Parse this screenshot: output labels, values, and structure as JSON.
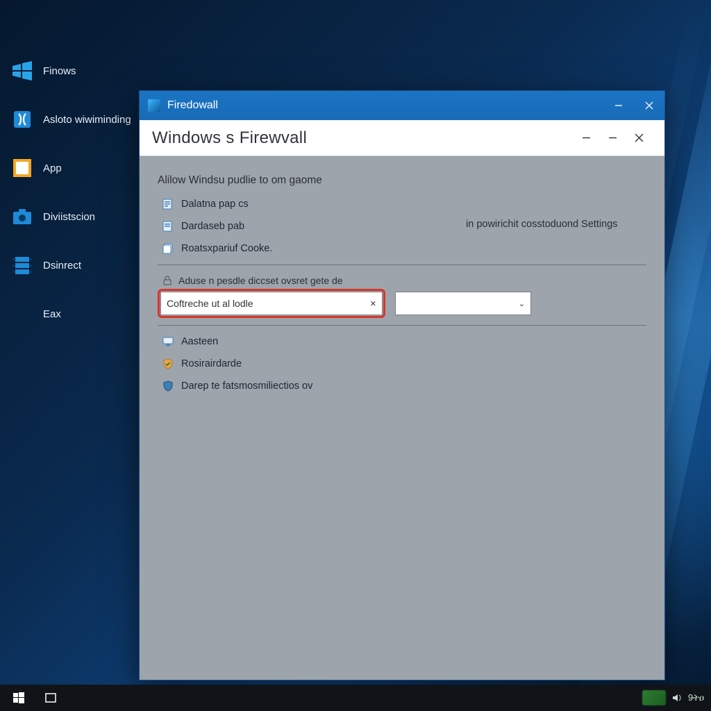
{
  "desktop": {
    "shortcuts": [
      {
        "label": "Finows"
      },
      {
        "label": "Asloto wiwiminding"
      },
      {
        "label": "App"
      },
      {
        "label": "Diviistscion"
      },
      {
        "label": "Dsinrect"
      },
      {
        "label": "Eax"
      }
    ]
  },
  "window": {
    "titlebar": "Firedowall",
    "page_title": "Windows s Firewvall",
    "section_title": "Alilow Windsu pudlie to om gaome",
    "settings_text": "in powirichit cosstoduond Settings",
    "links": [
      "Dalatna pap cs",
      "Dardaseb pab",
      "Roatsxpariuf Cooke."
    ],
    "label_above_combo": "Aduse n pesdle diccset ovsret gete de",
    "combo_value": "Coftreche ut al lodle",
    "more_links": [
      "Aasteen",
      "Rosirairdarde",
      "Darep te fatsmosmiliectios ov"
    ]
  },
  "taskbar": {
    "clock": "9ትዐ"
  }
}
